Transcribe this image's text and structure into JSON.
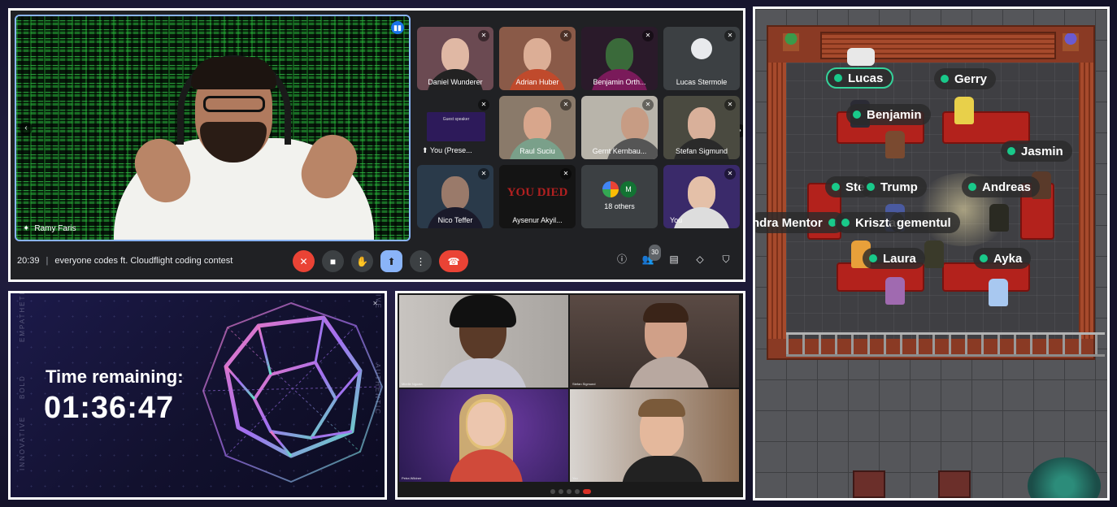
{
  "meet": {
    "speaker_name": "Ramy Faris",
    "time": "20:39",
    "separator": "|",
    "meeting_title": "everyone codes ft. Cloudflight coding contest",
    "participants_count": "30",
    "tiles": [
      {
        "name": "Daniel Wunderer"
      },
      {
        "name": "Adrian Huber"
      },
      {
        "name": "Benjamin Orth..."
      },
      {
        "name": "Lucas Stermole"
      },
      {
        "name": "You (Prese..."
      },
      {
        "name": "Raul Suciu"
      },
      {
        "name": "Gernt Kernbau..."
      },
      {
        "name": "Stefan Sigmund"
      },
      {
        "name": "Nico Teffer"
      },
      {
        "name": "Aysenur Akyil..."
      },
      {
        "name": "18 others",
        "initial": "M"
      },
      {
        "name": "You"
      }
    ],
    "presenting_screen_title": "Guest speaker",
    "dead_screen_text": "YOU DIED"
  },
  "gather": {
    "names": {
      "lucas": "Lucas",
      "gerry": "Gerry",
      "benjamin": "Benjamin",
      "jasmin": "Jasmin",
      "stefan_partial": "Ste",
      "trump": "Trump",
      "andreas": "Andreas",
      "alexandra_partial": "ndra Mentor",
      "krisztina_partial": "Kriszta",
      "emanuel_partial": "gementul",
      "laura": "Laura",
      "ayka": "Ayka"
    }
  },
  "timer": {
    "label": "Time remaining:",
    "value": "01:36:47",
    "side_words_left": [
      "EMPATHETIC",
      "BOLD",
      "INNOVATIVE"
    ],
    "side_words_right": [
      "INNOVATIVE",
      "AUTHENTIC"
    ]
  },
  "zoom": {
    "names": [
      "Mirelle Ngoala",
      "Stefan Sigmund",
      "Petra Wildner",
      "You"
    ]
  }
}
